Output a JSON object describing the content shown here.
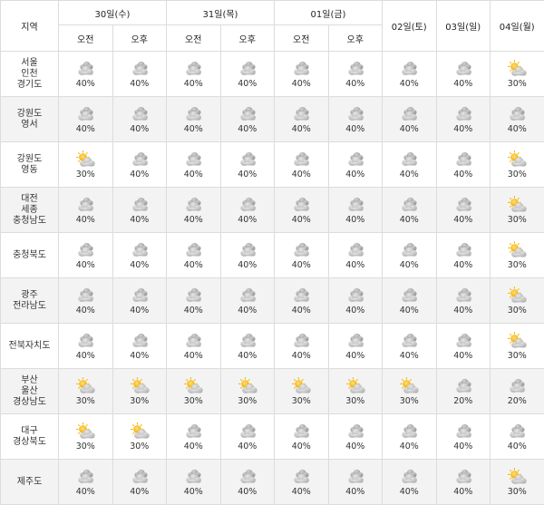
{
  "header": {
    "region_label": "지역",
    "days": [
      {
        "label": "30일(수)",
        "split": true
      },
      {
        "label": "31일(목)",
        "split": true
      },
      {
        "label": "01일(금)",
        "split": true
      },
      {
        "label": "02일(토)",
        "split": false
      },
      {
        "label": "03일(일)",
        "split": false
      },
      {
        "label": "04일(월)",
        "split": false
      }
    ],
    "am_label": "오전",
    "pm_label": "오후"
  },
  "icons": {
    "cloudy": "cloudy-icon",
    "partly_sunny": "partly-sunny-icon"
  },
  "colors": {
    "cloud": "#bdbdbd",
    "sun": "#f7b500",
    "grid": "#dcdcdc",
    "shade": "#f3f3f3"
  },
  "rows": [
    {
      "region": [
        "서울",
        "인천",
        "경기도"
      ],
      "cells": [
        {
          "icon": "cloudy",
          "pct": "40%"
        },
        {
          "icon": "cloudy",
          "pct": "40%"
        },
        {
          "icon": "cloudy",
          "pct": "40%"
        },
        {
          "icon": "cloudy",
          "pct": "40%"
        },
        {
          "icon": "cloudy",
          "pct": "40%"
        },
        {
          "icon": "cloudy",
          "pct": "40%"
        },
        {
          "icon": "cloudy",
          "pct": "40%"
        },
        {
          "icon": "cloudy",
          "pct": "40%"
        },
        {
          "icon": "partly_sunny",
          "pct": "30%"
        }
      ]
    },
    {
      "region": [
        "강원도",
        "영서"
      ],
      "cells": [
        {
          "icon": "cloudy",
          "pct": "40%"
        },
        {
          "icon": "cloudy",
          "pct": "40%"
        },
        {
          "icon": "cloudy",
          "pct": "40%"
        },
        {
          "icon": "cloudy",
          "pct": "40%"
        },
        {
          "icon": "cloudy",
          "pct": "40%"
        },
        {
          "icon": "cloudy",
          "pct": "40%"
        },
        {
          "icon": "cloudy",
          "pct": "40%"
        },
        {
          "icon": "cloudy",
          "pct": "40%"
        },
        {
          "icon": "cloudy",
          "pct": "40%"
        }
      ]
    },
    {
      "region": [
        "강원도",
        "영동"
      ],
      "cells": [
        {
          "icon": "partly_sunny",
          "pct": "30%"
        },
        {
          "icon": "cloudy",
          "pct": "40%"
        },
        {
          "icon": "cloudy",
          "pct": "40%"
        },
        {
          "icon": "cloudy",
          "pct": "40%"
        },
        {
          "icon": "cloudy",
          "pct": "40%"
        },
        {
          "icon": "cloudy",
          "pct": "40%"
        },
        {
          "icon": "cloudy",
          "pct": "40%"
        },
        {
          "icon": "cloudy",
          "pct": "40%"
        },
        {
          "icon": "partly_sunny",
          "pct": "30%"
        }
      ]
    },
    {
      "region": [
        "대전",
        "세종",
        "충청남도"
      ],
      "cells": [
        {
          "icon": "cloudy",
          "pct": "40%"
        },
        {
          "icon": "cloudy",
          "pct": "40%"
        },
        {
          "icon": "cloudy",
          "pct": "40%"
        },
        {
          "icon": "cloudy",
          "pct": "40%"
        },
        {
          "icon": "cloudy",
          "pct": "40%"
        },
        {
          "icon": "cloudy",
          "pct": "40%"
        },
        {
          "icon": "cloudy",
          "pct": "40%"
        },
        {
          "icon": "cloudy",
          "pct": "40%"
        },
        {
          "icon": "partly_sunny",
          "pct": "30%"
        }
      ]
    },
    {
      "region": [
        "충청북도"
      ],
      "cells": [
        {
          "icon": "cloudy",
          "pct": "40%"
        },
        {
          "icon": "cloudy",
          "pct": "40%"
        },
        {
          "icon": "cloudy",
          "pct": "40%"
        },
        {
          "icon": "cloudy",
          "pct": "40%"
        },
        {
          "icon": "cloudy",
          "pct": "40%"
        },
        {
          "icon": "cloudy",
          "pct": "40%"
        },
        {
          "icon": "cloudy",
          "pct": "40%"
        },
        {
          "icon": "cloudy",
          "pct": "40%"
        },
        {
          "icon": "partly_sunny",
          "pct": "30%"
        }
      ]
    },
    {
      "region": [
        "광주",
        "전라남도"
      ],
      "cells": [
        {
          "icon": "cloudy",
          "pct": "40%"
        },
        {
          "icon": "cloudy",
          "pct": "40%"
        },
        {
          "icon": "cloudy",
          "pct": "40%"
        },
        {
          "icon": "cloudy",
          "pct": "40%"
        },
        {
          "icon": "cloudy",
          "pct": "40%"
        },
        {
          "icon": "cloudy",
          "pct": "40%"
        },
        {
          "icon": "cloudy",
          "pct": "40%"
        },
        {
          "icon": "cloudy",
          "pct": "40%"
        },
        {
          "icon": "partly_sunny",
          "pct": "30%"
        }
      ]
    },
    {
      "region": [
        "전북자치도"
      ],
      "cells": [
        {
          "icon": "cloudy",
          "pct": "40%"
        },
        {
          "icon": "cloudy",
          "pct": "40%"
        },
        {
          "icon": "cloudy",
          "pct": "40%"
        },
        {
          "icon": "cloudy",
          "pct": "40%"
        },
        {
          "icon": "cloudy",
          "pct": "40%"
        },
        {
          "icon": "cloudy",
          "pct": "40%"
        },
        {
          "icon": "cloudy",
          "pct": "40%"
        },
        {
          "icon": "cloudy",
          "pct": "40%"
        },
        {
          "icon": "partly_sunny",
          "pct": "30%"
        }
      ]
    },
    {
      "region": [
        "부산",
        "울산",
        "경상남도"
      ],
      "cells": [
        {
          "icon": "partly_sunny",
          "pct": "30%"
        },
        {
          "icon": "partly_sunny",
          "pct": "30%"
        },
        {
          "icon": "partly_sunny",
          "pct": "30%"
        },
        {
          "icon": "partly_sunny",
          "pct": "30%"
        },
        {
          "icon": "partly_sunny",
          "pct": "30%"
        },
        {
          "icon": "partly_sunny",
          "pct": "30%"
        },
        {
          "icon": "partly_sunny",
          "pct": "30%"
        },
        {
          "icon": "cloudy",
          "pct": "20%"
        },
        {
          "icon": "cloudy",
          "pct": "20%"
        }
      ]
    },
    {
      "region": [
        "대구",
        "경상북도"
      ],
      "cells": [
        {
          "icon": "partly_sunny",
          "pct": "30%"
        },
        {
          "icon": "partly_sunny",
          "pct": "30%"
        },
        {
          "icon": "cloudy",
          "pct": "40%"
        },
        {
          "icon": "cloudy",
          "pct": "40%"
        },
        {
          "icon": "cloudy",
          "pct": "40%"
        },
        {
          "icon": "cloudy",
          "pct": "40%"
        },
        {
          "icon": "cloudy",
          "pct": "40%"
        },
        {
          "icon": "cloudy",
          "pct": "40%"
        },
        {
          "icon": "cloudy",
          "pct": "40%"
        }
      ]
    },
    {
      "region": [
        "제주도"
      ],
      "cells": [
        {
          "icon": "cloudy",
          "pct": "40%"
        },
        {
          "icon": "cloudy",
          "pct": "40%"
        },
        {
          "icon": "cloudy",
          "pct": "40%"
        },
        {
          "icon": "cloudy",
          "pct": "40%"
        },
        {
          "icon": "cloudy",
          "pct": "40%"
        },
        {
          "icon": "cloudy",
          "pct": "40%"
        },
        {
          "icon": "cloudy",
          "pct": "40%"
        },
        {
          "icon": "cloudy",
          "pct": "40%"
        },
        {
          "icon": "partly_sunny",
          "pct": "30%"
        }
      ]
    }
  ]
}
